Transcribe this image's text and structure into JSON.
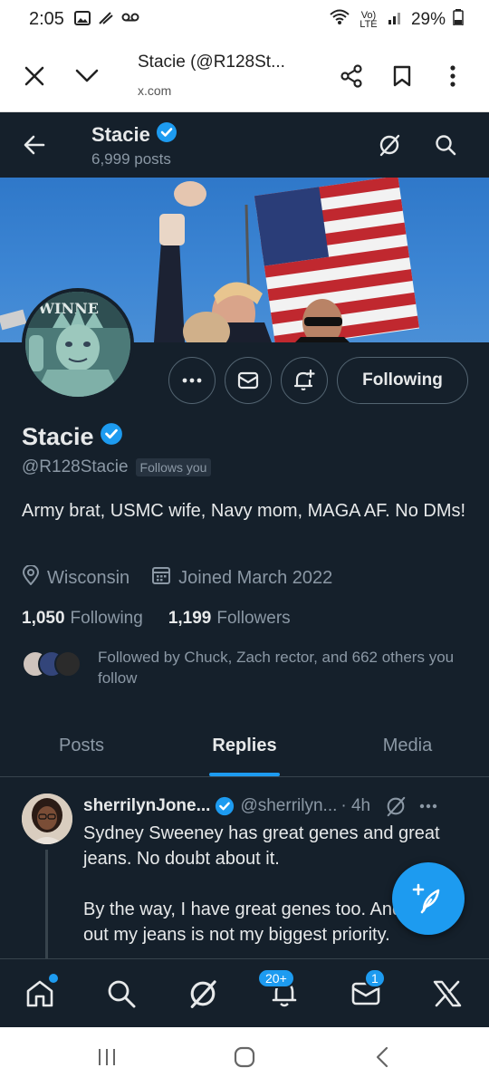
{
  "status_bar": {
    "time": "2:05",
    "lte": "Vo) LTE",
    "battery": "29%"
  },
  "browser": {
    "title": "Stacie (@R128St...",
    "url": "x.com"
  },
  "header": {
    "name": "Stacie",
    "posts": "6,999 posts"
  },
  "profile": {
    "name": "Stacie",
    "handle": "@R128Stacie",
    "follows_you": "Follows you",
    "bio": "Army brat, USMC wife, Navy mom, MAGA AF.  No DMs!",
    "location": "Wisconsin",
    "joined": "Joined March 2022",
    "following_count": "1,050",
    "following_label": "Following",
    "followers_count": "1,199",
    "followers_label": "Followers",
    "followed_by": "Followed by Chuck, Zach rector, and 662 others you follow",
    "following_button": "Following",
    "avatar_text": "WINNE"
  },
  "tabs": [
    {
      "label": "Posts"
    },
    {
      "label": "Replies"
    },
    {
      "label": "Media"
    }
  ],
  "tweet": {
    "name": "sherrilynJone...",
    "handle": "@sherrilyn...",
    "time": "· 4h",
    "para1": "Sydney Sweeney has great genes and great jeans. No doubt about it.",
    "para2": "By the way, I have great genes too. And filling out my jeans is not my biggest priority."
  },
  "bottom_nav": {
    "notifications_badge": "20+",
    "messages_badge": "1"
  },
  "colors": {
    "background": "#15202b",
    "accent": "#1d9bf0",
    "muted": "#8b98a5"
  }
}
